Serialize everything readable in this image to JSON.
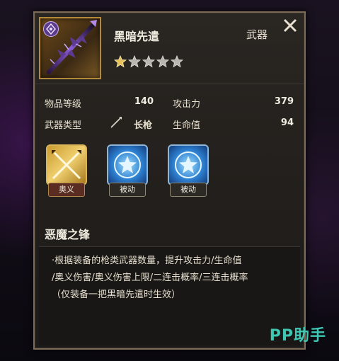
{
  "item": {
    "name": "黑暗先遣",
    "category": "武器",
    "rarity_stars_filled": 1,
    "rarity_stars_total": 5
  },
  "stats": {
    "item_level_label": "物品等级",
    "item_level_value": "140",
    "attack_label": "攻击力",
    "attack_value": "379",
    "weapon_type_label": "武器类型",
    "weapon_type_value": "长枪",
    "hp_label": "生命值",
    "hp_value": "94"
  },
  "skills": [
    {
      "tag": "奥义",
      "icon": "crossed-spears-icon"
    },
    {
      "tag": "被动",
      "icon": "star-shield-icon"
    },
    {
      "tag": "被动",
      "icon": "star-shield-icon"
    }
  ],
  "skill_detail": {
    "title": "恶魔之锋",
    "lines": [
      "·根据装备的枪类武器数量，提升攻击力/生命值",
      "/奥义伤害/奥义伤害上限/二连击概率/三连击概率",
      "（仅装备一把黑暗先遣时生效）"
    ]
  },
  "watermark": "PP助手",
  "colors": {
    "accent_gold": "#b38a3a",
    "watermark": "#3ec7b2"
  }
}
